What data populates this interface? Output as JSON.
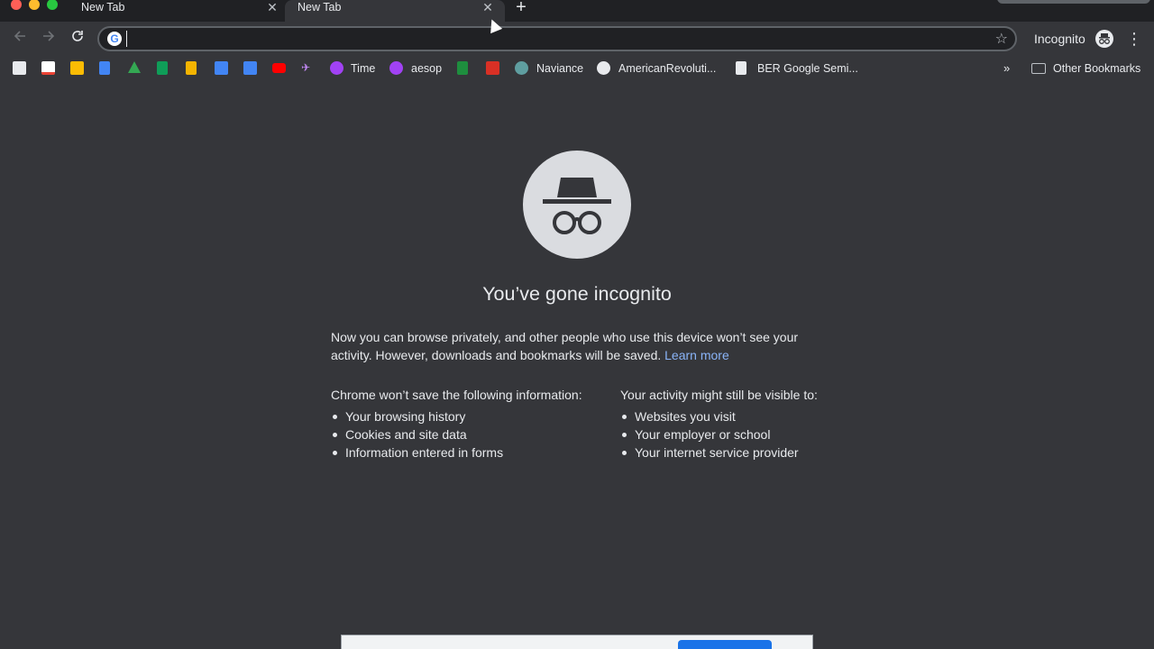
{
  "tabs": [
    {
      "title": "New Tab",
      "active": false
    },
    {
      "title": "New Tab",
      "active": true
    }
  ],
  "tab_close_glyph": "✕",
  "new_tab_glyph": "+",
  "omnibox": {
    "value": "",
    "placeholder": ""
  },
  "profile": {
    "label": "Incognito"
  },
  "bookmarks": [
    {
      "icon": "bookmark-icon-1",
      "color": "#e8eaed",
      "label": ""
    },
    {
      "icon": "gmail-icon",
      "color": "#ea4335",
      "label": ""
    },
    {
      "icon": "photos-icon",
      "color": "#fbbc04",
      "label": ""
    },
    {
      "icon": "docs-icon",
      "color": "#4285f4",
      "label": ""
    },
    {
      "icon": "drive-icon",
      "color": "#34a853",
      "label": ""
    },
    {
      "icon": "sheets-icon",
      "color": "#0f9d58",
      "label": ""
    },
    {
      "icon": "slides-icon",
      "color": "#f4b400",
      "label": ""
    },
    {
      "icon": "calendar-icon",
      "color": "#4285f4",
      "label": ""
    },
    {
      "icon": "keep-icon",
      "color": "#4285f4",
      "label": ""
    },
    {
      "icon": "youtube-icon",
      "color": "#ff0000",
      "label": ""
    },
    {
      "icon": "bird-icon",
      "color": "#c58af9",
      "label": ""
    },
    {
      "icon": "time-icon",
      "color": "#a142f4",
      "label": "Time"
    },
    {
      "icon": "aesop-icon",
      "color": "#a142f4",
      "label": "aesop"
    },
    {
      "icon": "p-icon",
      "color": "#1e8e3e",
      "label": ""
    },
    {
      "icon": "calendar-box-icon",
      "color": "#d93025",
      "label": ""
    },
    {
      "icon": "naviance-icon",
      "color": "#5f9ea0",
      "label": "Naviance"
    },
    {
      "icon": "globe-icon",
      "color": "#e8eaed",
      "label": "AmericanRevoluti..."
    },
    {
      "icon": "doc-icon",
      "color": "#e8eaed",
      "label": "BER Google Semi..."
    }
  ],
  "bookmarks_overflow": "»",
  "other_bookmarks": "Other Bookmarks",
  "main": {
    "headline": "You’ve gone incognito",
    "intro_text": "Now you can browse privately, and other people who use this device won’t see your activity. However, downloads and bookmarks will be saved.",
    "learn_more": "Learn more",
    "left_title": "Chrome won’t save the following information:",
    "left_items": [
      "Your browsing history",
      "Cookies and site data",
      "Information entered in forms"
    ],
    "right_title": "Your activity might still be visible to:",
    "right_items": [
      "Websites you visit",
      "Your employer or school",
      "Your internet service provider"
    ]
  }
}
